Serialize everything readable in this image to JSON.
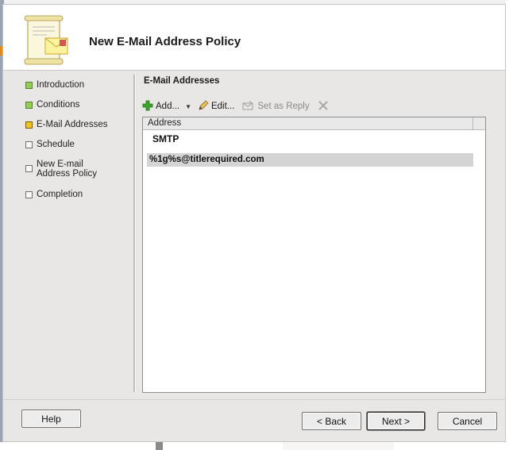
{
  "dialog": {
    "title": "New E-Mail Address Policy"
  },
  "steps": [
    {
      "label": "Introduction",
      "state": "done"
    },
    {
      "label": "Conditions",
      "state": "done"
    },
    {
      "label": "E-Mail Addresses",
      "state": "current"
    },
    {
      "label": "Schedule",
      "state": "pending"
    },
    {
      "label": "New E-mail Address Policy",
      "state": "pending"
    },
    {
      "label": "Completion",
      "state": "pending"
    }
  ],
  "section": {
    "title": "E-Mail Addresses"
  },
  "toolbar": {
    "add_label": "Add...",
    "edit_label": "Edit...",
    "set_reply_label": "Set as Reply"
  },
  "grid": {
    "column_header": "Address",
    "group_label": "SMTP",
    "rows": [
      "%1g%s@titlerequired.com"
    ]
  },
  "buttons": {
    "help": "Help",
    "back": "< Back",
    "next": "Next >",
    "cancel": "Cancel"
  },
  "colors": {
    "step_done": "#8fd14f",
    "step_current": "#f0c419",
    "add_icon": "#3aa62c",
    "selected_row": "#d4d4d4"
  }
}
